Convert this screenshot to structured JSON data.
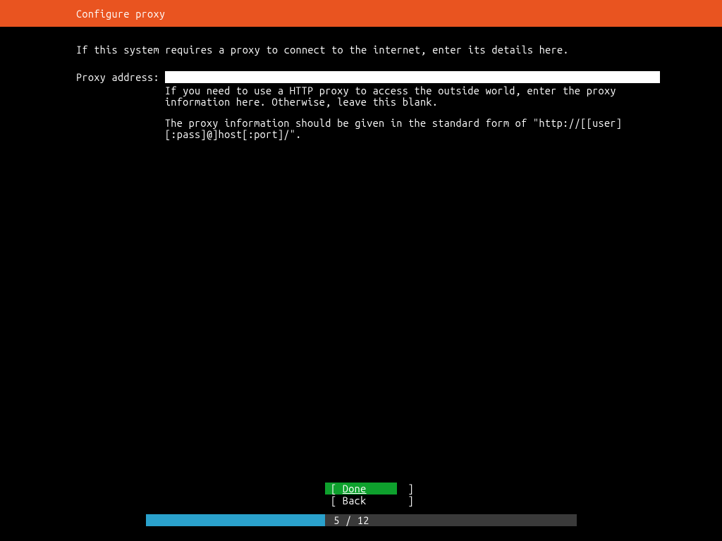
{
  "header": {
    "title": "Configure proxy"
  },
  "main": {
    "instruction": "If this system requires a proxy to connect to the internet, enter its details here.",
    "field": {
      "label": "Proxy address:",
      "value": ""
    },
    "help": {
      "line1": "If you need to use a HTTP proxy to access the outside world, enter the proxy information here. Otherwise, leave this blank.",
      "line2": "The proxy information should be given in the standard form of \"http://[[user][:pass]@]host[:port]/\"."
    }
  },
  "buttons": {
    "done": "Done",
    "back": "Back"
  },
  "progress": {
    "current": 5,
    "total": 12,
    "text": "5 / 12"
  }
}
